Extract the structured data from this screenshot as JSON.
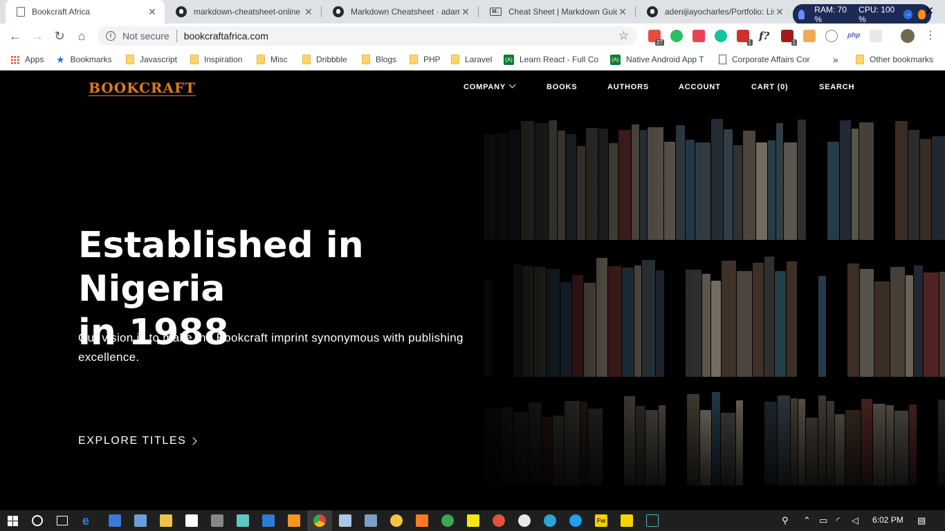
{
  "browser": {
    "tabs": [
      {
        "title": "Bookcraft Africa",
        "favicon": "document-icon",
        "active": true
      },
      {
        "title": "markdown-cheatsheet-online",
        "favicon": "github-icon"
      },
      {
        "title": "Markdown Cheatsheet · adam-p",
        "favicon": "github-icon"
      },
      {
        "title": "Cheat Sheet | Markdown Guide",
        "favicon": "markdown-icon"
      },
      {
        "title": "adenijiayocharles/Portfolio: Lis",
        "favicon": "github-icon"
      }
    ],
    "system_widget": {
      "ram": "RAM: 70 %",
      "cpu": "CPU: 100 %"
    },
    "address": {
      "security": "Not secure",
      "url": "bookcraftafrica.com"
    },
    "extension_badges": {
      "badge1": "27",
      "badge2": "1",
      "badge3": "1"
    },
    "bookmarks": [
      {
        "label": "Apps",
        "icon": "apps-grid-icon"
      },
      {
        "label": "Bookmarks",
        "icon": "star-icon"
      },
      {
        "label": "Javascript",
        "icon": "folder-icon"
      },
      {
        "label": "Inspiration",
        "icon": "folder-icon"
      },
      {
        "label": "Misc",
        "icon": "folder-icon"
      },
      {
        "label": "Dribbble",
        "icon": "folder-icon"
      },
      {
        "label": "Blogs",
        "icon": "folder-icon"
      },
      {
        "label": "PHP",
        "icon": "folder-icon"
      },
      {
        "label": "Laravel",
        "icon": "folder-icon"
      },
      {
        "label": "Learn React - Full Co",
        "icon": "learn-icon"
      },
      {
        "label": "Native Android App T",
        "icon": "learn-icon"
      },
      {
        "label": "Corporate Affairs Cor",
        "icon": "page-icon"
      }
    ],
    "bookmarks_overflow": "»",
    "other_bookmarks": "Other bookmarks"
  },
  "site": {
    "logo": "BOOKCRAFT",
    "nav": {
      "company": "COMPANY",
      "books": "BOOKS",
      "authors": "AUTHORS",
      "account": "ACCOUNT",
      "cart": "CART (0)",
      "search": "SEARCH"
    },
    "hero": {
      "title_line1": "Established in Nigeria",
      "title_line2": "in 1988",
      "subtitle": "Our vision is to make the Bookcraft imprint synonymous with publishing excellence.",
      "cta": "EXPLORE TITLES"
    },
    "colors": {
      "logo": "#e07a1e",
      "background": "#000000",
      "text": "#ffffff"
    }
  },
  "taskbar": {
    "clock": "6:02 PM"
  }
}
